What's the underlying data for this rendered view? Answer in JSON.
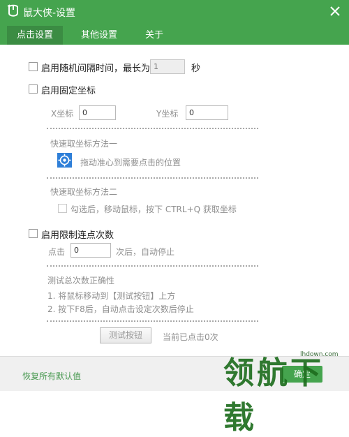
{
  "window": {
    "title": "鼠大侠-设置",
    "logo_icon": "mouse-logo-icon",
    "close_icon": "close-icon"
  },
  "tabs": [
    {
      "label": "点击设置",
      "active": true
    },
    {
      "label": "其他设置",
      "active": false
    },
    {
      "label": "关于",
      "active": false
    }
  ],
  "random_interval": {
    "label": "启用随机间隔时间，最长为",
    "value": "1",
    "unit": "秒",
    "checked": false
  },
  "fixed_coord": {
    "label": "启用固定坐标",
    "checked": false,
    "x_label": "X坐标",
    "x_value": "0",
    "y_label": "Y坐标",
    "y_value": "0",
    "method1_title": "快速取坐标方法一",
    "method1_hint": "拖动准心到需要点击的位置",
    "target_icon": "crosshair-icon",
    "method2_title": "快速取坐标方法二",
    "method2_label": "勾选后，移动鼠标，按下 CTRL+Q 获取坐标"
  },
  "limit_clicks": {
    "label": "启用限制连点次数",
    "checked": false,
    "click_label": "点击",
    "count_value": "0",
    "after_label": "次后，自动停止",
    "test_title": "测试总次数正确性",
    "step1": "1. 将鼠标移动到【测试按钮】上方",
    "step2": "2. 按下F8后，自动点击设定次数后停止",
    "test_button": "测试按钮",
    "status": "当前已点击0次"
  },
  "footer": {
    "restore_link": "恢复所有默认值",
    "ok_button": "确定"
  },
  "watermark": {
    "text": "领航下载",
    "url": "lhdown.com"
  },
  "colors": {
    "brand_green": "#45a44e",
    "active_tab": "#3b8c43"
  }
}
